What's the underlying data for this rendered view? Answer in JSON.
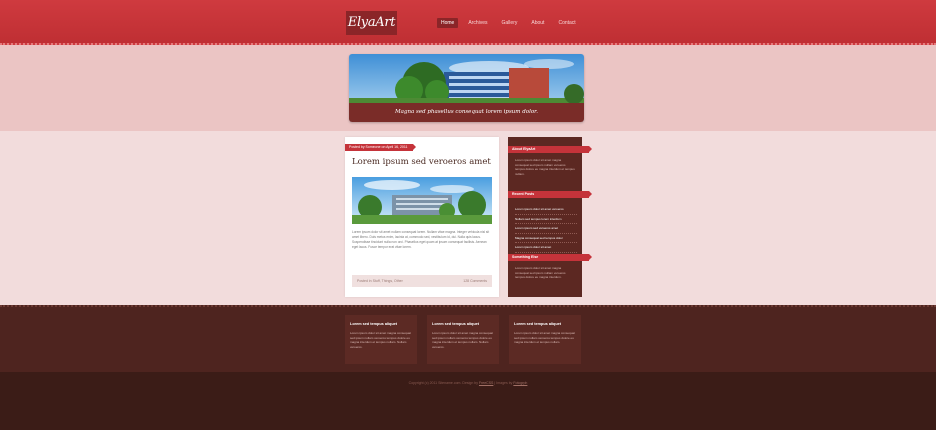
{
  "site": {
    "logo": "ElyaArt",
    "nav": [
      "Home",
      "Archives",
      "Gallery",
      "About",
      "Contact"
    ]
  },
  "banner": {
    "caption": "Magna sed phasellus consequat lorem ipsum dolor."
  },
  "post": {
    "date": "Posted by Someone on April 16, 2011",
    "title": "Lorem ipsum sed veroeros amet",
    "body": "Lorem ipsum dolor sit amet nullam consequat lorem. Nullam vitae magna. Integer vehicula nisl sit amet libero. Duis metus enim, lacinia at, commodo sed, vestibulum id, dui. Nulla quis lacus. Suspendisse tincidunt nulla non orci. Phasellus eget quam at ipsum consequat facilisis. Aenean eget lacus. Fusce tempor erat vitae lorem.",
    "posted_in": "Posted in Stuff, Things, Other",
    "comments": "128 Comments"
  },
  "sidebar": {
    "about_title": "About ElyaArt",
    "about_text": "Lorem ipsum dolor sit amet magna consequat sed ipsum nullam veroeros tempus dolore eu magna interdum et tempus nullam.",
    "recent_title": "Recent Posts",
    "recent_items": [
      "Lorem ipsum dolor sit amet veroeros",
      "Nullam sed tempus lorem interdum",
      "Lorem ipsum sed veroeros amet",
      "Magna consequat sed tempus dolor",
      "Lorem ipsum dolor sit amet"
    ],
    "something_title": "Something Else",
    "something_text": "Lorem ipsum dolor sit amet magna consequat sed ipsum nullam veroeros tempus dolore eu magna interdum."
  },
  "footer": {
    "boxes": [
      {
        "title": "Lorem sed tempus aliquet",
        "text": "Lorem ipsum dolor sit amet magna consequat sed ipsum nullam veroeros tempus dolore eu magna interdum et tempus nullam. Nullam veroeros."
      },
      {
        "title": "Lorem sed tempus aliquet",
        "text": "Lorem ipsum dolor sit amet magna consequat sed ipsum nullam veroeros tempus dolore eu magna interdum et tempus nullam. Nullam veroeros."
      },
      {
        "title": "Lorem sed tempus aliquet",
        "text": "Lorem ipsum dolor sit amet magna consequat sed ipsum nullam veroeros tempus dolore eu magna interdum et tempus nullam."
      }
    ],
    "copyright_prefix": "Copyright (c) 2011 Sitename.com. Design by",
    "copyright_link": "FreeCSS",
    "copyright_mid": "| Images by",
    "copyright_link2": "Fotogrph"
  },
  "colors": {
    "header": "#c93338",
    "banner_band": "#ebc5c4",
    "content_band": "#f2dcdc",
    "sidebar": "#5c2822",
    "footer": "#4e241f",
    "accent": "#c5333a"
  }
}
